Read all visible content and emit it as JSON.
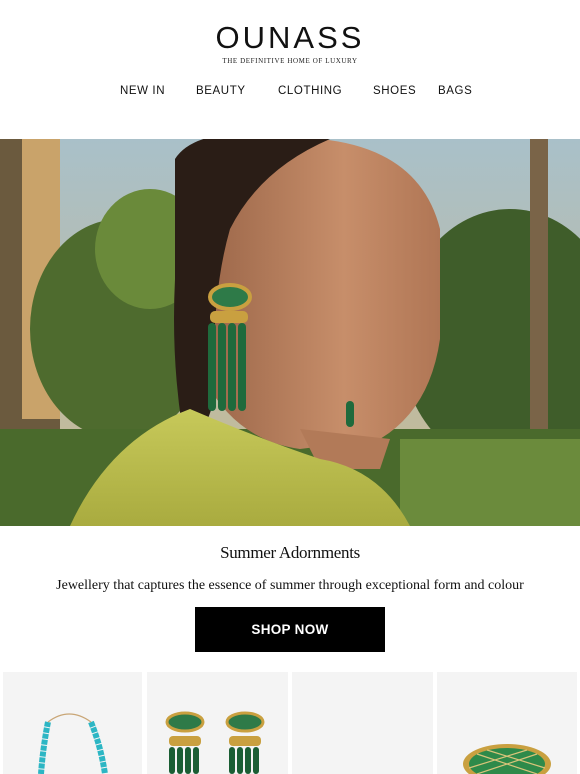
{
  "header": {
    "logo": "OUNASS",
    "tagline": "THE DEFINITIVE HOME OF LUXURY"
  },
  "nav": {
    "items": [
      {
        "label": "NEW IN"
      },
      {
        "label": "BEAUTY"
      },
      {
        "label": "CLOTHING"
      },
      {
        "label": "SHOES"
      },
      {
        "label": "BAGS"
      }
    ]
  },
  "hero": {
    "image": "woman-wearing-green-malachite-tassel-earrings"
  },
  "feature": {
    "title": "Summer Adornments",
    "description": "Jewellery that captures the essence of summer through exceptional form and colour",
    "cta_label": "SHOP NOW"
  },
  "products": [
    {
      "image": "turquoise-bead-necklace"
    },
    {
      "image": "green-eye-tassel-earrings"
    },
    {
      "image": "blank-product"
    },
    {
      "image": "green-enamel-ring"
    }
  ],
  "colors": {
    "accent": "#000000",
    "background": "#ffffff",
    "product_tile": "#f4f4f4"
  }
}
